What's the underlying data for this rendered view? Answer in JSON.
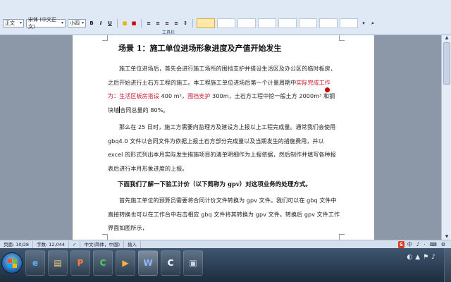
{
  "ribbon": {
    "style_combo": "正文",
    "font_combo": "宋体 (中文正文)",
    "size_combo": "小四",
    "format_buttons": [
      "B",
      "I",
      "U"
    ],
    "group_label": "工具栏"
  },
  "document": {
    "heading": "场景 1：施工单位进场形象进度及产值开始发生",
    "p1": {
      "a": "施工单位进场后，首先会进行施工场所的围挡支护并搭设生活区及办公区的临时板房，之后开始进行土石方工程的施工。本工程施工单位进场后第一个计量周期中",
      "r1": "实际完成工作为",
      "b": "：",
      "r2": "生活区板房搭设",
      "c": " 400 m²，",
      "r3": "围挡支护",
      "d": " 300m，土石方工程中挖一般土方 2000m³ 和钢块墙",
      "e": "合同总量的 80%。"
    },
    "p2": "那么在 25 日时，施工方需要向监理方及建设方上报以上工程完成量。通常我们会使用 gbq4.0 文件以合同文件为依据上报土石方部分完成量以及当期发生的措施费用，并以 excel 的形式列出本月实际发生措施项目的清单明细作为上报依据，然后制作并填写各种报表后进行本月形象进度的上报。",
    "subheading": "下面我们了解一下验工计价（以下简称为 gpv）对这项业务的处理方式。",
    "p3": "首先施工单位的预算员需要将合同计价文件转换为 gpv 文件。我们可以在 gbq 文件中直接转换也可以在工作台中右击相应 gbq 文件将其转换为 gpv 文件。转换后 gpv 文件工作界面如图所示，"
  },
  "statusbar": {
    "page": "页面: 10/28",
    "words": "字数: 12,044",
    "lang": "中文(简体，中国)",
    "mode": "插入"
  },
  "ime": {
    "logo": "S",
    "items": [
      "中",
      "♪",
      "·",
      "⌨",
      "⚙"
    ]
  },
  "taskbar": {
    "apps": [
      {
        "name": "ie",
        "glyph": "e"
      },
      {
        "name": "explorer",
        "glyph": "▤"
      },
      {
        "name": "ppt",
        "glyph": "P"
      },
      {
        "name": "gcl",
        "glyph": "C"
      },
      {
        "name": "media",
        "glyph": "▶"
      },
      {
        "name": "word",
        "glyph": "W"
      },
      {
        "name": "gbq",
        "glyph": "C"
      },
      {
        "name": "app8",
        "glyph": "▣"
      }
    ],
    "tray": [
      "◐",
      "▲",
      "⚑",
      "♪"
    ]
  },
  "colors": {
    "accent_red": "#d0142a",
    "taskbar_top": "#3e566f",
    "ribbon_bg": "#dfe8f5"
  }
}
